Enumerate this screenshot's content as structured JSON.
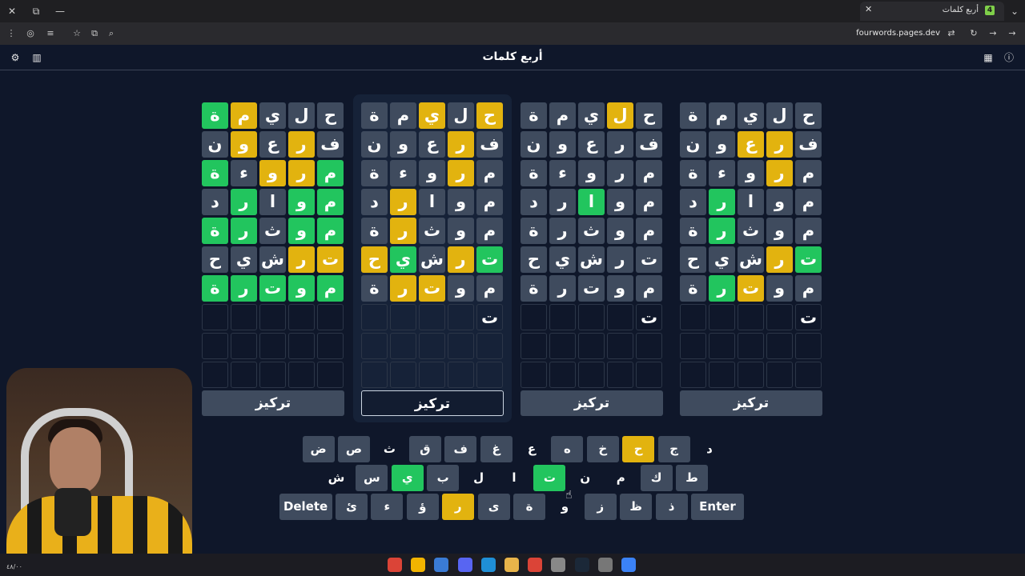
{
  "browser": {
    "tab_title": "أربع كلمات",
    "favicon_glyph": "4",
    "url": "fourwords.pages.dev"
  },
  "app": {
    "title": "أربع كلمات",
    "icons": {
      "settings": "gear-icon",
      "stats": "bar-chart-icon",
      "calendar": "calendar-icon",
      "info": "info-icon"
    }
  },
  "colors": {
    "correct": "#22c55e",
    "present": "#e2b30f",
    "absent": "#3f4b5e",
    "background": "#0f172a"
  },
  "boards": [
    {
      "focus_label": "تركيز",
      "active": false,
      "rows": [
        [
          {
            "l": "ح",
            "s": "a"
          },
          {
            "l": "ل",
            "s": "a"
          },
          {
            "l": "ي",
            "s": "a"
          },
          {
            "l": "م",
            "s": "y"
          },
          {
            "l": "ة",
            "s": "g"
          }
        ],
        [
          {
            "l": "ف",
            "s": "a"
          },
          {
            "l": "ر",
            "s": "y"
          },
          {
            "l": "ع",
            "s": "a"
          },
          {
            "l": "و",
            "s": "y"
          },
          {
            "l": "ن",
            "s": "a"
          }
        ],
        [
          {
            "l": "م",
            "s": "g"
          },
          {
            "l": "ر",
            "s": "y"
          },
          {
            "l": "و",
            "s": "y"
          },
          {
            "l": "ء",
            "s": "a"
          },
          {
            "l": "ة",
            "s": "g"
          }
        ],
        [
          {
            "l": "م",
            "s": "g"
          },
          {
            "l": "و",
            "s": "g"
          },
          {
            "l": "ا",
            "s": "a"
          },
          {
            "l": "ر",
            "s": "g"
          },
          {
            "l": "د",
            "s": "a"
          }
        ],
        [
          {
            "l": "م",
            "s": "g"
          },
          {
            "l": "و",
            "s": "g"
          },
          {
            "l": "ث",
            "s": "a"
          },
          {
            "l": "ر",
            "s": "g"
          },
          {
            "l": "ة",
            "s": "g"
          }
        ],
        [
          {
            "l": "ت",
            "s": "y"
          },
          {
            "l": "ر",
            "s": "y"
          },
          {
            "l": "ش",
            "s": "a"
          },
          {
            "l": "ي",
            "s": "a"
          },
          {
            "l": "ح",
            "s": "a"
          }
        ],
        [
          {
            "l": "م",
            "s": "g"
          },
          {
            "l": "و",
            "s": "g"
          },
          {
            "l": "ت",
            "s": "g"
          },
          {
            "l": "ر",
            "s": "g"
          },
          {
            "l": "ة",
            "s": "g"
          }
        ],
        [
          {
            "l": "",
            "s": "e"
          },
          {
            "l": "",
            "s": "e"
          },
          {
            "l": "",
            "s": "e"
          },
          {
            "l": "",
            "s": "e"
          },
          {
            "l": "",
            "s": "e"
          }
        ],
        [
          {
            "l": "",
            "s": "e"
          },
          {
            "l": "",
            "s": "e"
          },
          {
            "l": "",
            "s": "e"
          },
          {
            "l": "",
            "s": "e"
          },
          {
            "l": "",
            "s": "e"
          }
        ],
        [
          {
            "l": "",
            "s": "e"
          },
          {
            "l": "",
            "s": "e"
          },
          {
            "l": "",
            "s": "e"
          },
          {
            "l": "",
            "s": "e"
          },
          {
            "l": "",
            "s": "e"
          }
        ]
      ]
    },
    {
      "focus_label": "تركيز",
      "active": true,
      "rows": [
        [
          {
            "l": "ح",
            "s": "y"
          },
          {
            "l": "ل",
            "s": "a"
          },
          {
            "l": "ي",
            "s": "y"
          },
          {
            "l": "م",
            "s": "a"
          },
          {
            "l": "ة",
            "s": "a"
          }
        ],
        [
          {
            "l": "ف",
            "s": "a"
          },
          {
            "l": "ر",
            "s": "y"
          },
          {
            "l": "ع",
            "s": "a"
          },
          {
            "l": "و",
            "s": "a"
          },
          {
            "l": "ن",
            "s": "a"
          }
        ],
        [
          {
            "l": "م",
            "s": "a"
          },
          {
            "l": "ر",
            "s": "y"
          },
          {
            "l": "و",
            "s": "a"
          },
          {
            "l": "ء",
            "s": "a"
          },
          {
            "l": "ة",
            "s": "a"
          }
        ],
        [
          {
            "l": "م",
            "s": "a"
          },
          {
            "l": "و",
            "s": "a"
          },
          {
            "l": "ا",
            "s": "a"
          },
          {
            "l": "ر",
            "s": "y"
          },
          {
            "l": "د",
            "s": "a"
          }
        ],
        [
          {
            "l": "م",
            "s": "a"
          },
          {
            "l": "و",
            "s": "a"
          },
          {
            "l": "ث",
            "s": "a"
          },
          {
            "l": "ر",
            "s": "y"
          },
          {
            "l": "ة",
            "s": "a"
          }
        ],
        [
          {
            "l": "ت",
            "s": "g"
          },
          {
            "l": "ر",
            "s": "y"
          },
          {
            "l": "ش",
            "s": "a"
          },
          {
            "l": "ي",
            "s": "g"
          },
          {
            "l": "ح",
            "s": "y"
          }
        ],
        [
          {
            "l": "م",
            "s": "a"
          },
          {
            "l": "و",
            "s": "a"
          },
          {
            "l": "ت",
            "s": "y"
          },
          {
            "l": "ر",
            "s": "y"
          },
          {
            "l": "ة",
            "s": "a"
          }
        ],
        [
          {
            "l": "ت",
            "s": "c"
          },
          {
            "l": "",
            "s": "e"
          },
          {
            "l": "",
            "s": "e"
          },
          {
            "l": "",
            "s": "e"
          },
          {
            "l": "",
            "s": "e"
          }
        ],
        [
          {
            "l": "",
            "s": "e"
          },
          {
            "l": "",
            "s": "e"
          },
          {
            "l": "",
            "s": "e"
          },
          {
            "l": "",
            "s": "e"
          },
          {
            "l": "",
            "s": "e"
          }
        ],
        [
          {
            "l": "",
            "s": "e"
          },
          {
            "l": "",
            "s": "e"
          },
          {
            "l": "",
            "s": "e"
          },
          {
            "l": "",
            "s": "e"
          },
          {
            "l": "",
            "s": "e"
          }
        ]
      ]
    },
    {
      "focus_label": "تركيز",
      "active": false,
      "rows": [
        [
          {
            "l": "ح",
            "s": "a"
          },
          {
            "l": "ل",
            "s": "y"
          },
          {
            "l": "ي",
            "s": "a"
          },
          {
            "l": "م",
            "s": "a"
          },
          {
            "l": "ة",
            "s": "a"
          }
        ],
        [
          {
            "l": "ف",
            "s": "a"
          },
          {
            "l": "ر",
            "s": "a"
          },
          {
            "l": "ع",
            "s": "a"
          },
          {
            "l": "و",
            "s": "a"
          },
          {
            "l": "ن",
            "s": "a"
          }
        ],
        [
          {
            "l": "م",
            "s": "a"
          },
          {
            "l": "ر",
            "s": "a"
          },
          {
            "l": "و",
            "s": "a"
          },
          {
            "l": "ء",
            "s": "a"
          },
          {
            "l": "ة",
            "s": "a"
          }
        ],
        [
          {
            "l": "م",
            "s": "a"
          },
          {
            "l": "و",
            "s": "a"
          },
          {
            "l": "ا",
            "s": "g"
          },
          {
            "l": "ر",
            "s": "a"
          },
          {
            "l": "د",
            "s": "a"
          }
        ],
        [
          {
            "l": "م",
            "s": "a"
          },
          {
            "l": "و",
            "s": "a"
          },
          {
            "l": "ث",
            "s": "a"
          },
          {
            "l": "ر",
            "s": "a"
          },
          {
            "l": "ة",
            "s": "a"
          }
        ],
        [
          {
            "l": "ت",
            "s": "a"
          },
          {
            "l": "ر",
            "s": "a"
          },
          {
            "l": "ش",
            "s": "a"
          },
          {
            "l": "ي",
            "s": "a"
          },
          {
            "l": "ح",
            "s": "a"
          }
        ],
        [
          {
            "l": "م",
            "s": "a"
          },
          {
            "l": "و",
            "s": "a"
          },
          {
            "l": "ت",
            "s": "a"
          },
          {
            "l": "ر",
            "s": "a"
          },
          {
            "l": "ة",
            "s": "a"
          }
        ],
        [
          {
            "l": "ت",
            "s": "c"
          },
          {
            "l": "",
            "s": "e"
          },
          {
            "l": "",
            "s": "e"
          },
          {
            "l": "",
            "s": "e"
          },
          {
            "l": "",
            "s": "e"
          }
        ],
        [
          {
            "l": "",
            "s": "e"
          },
          {
            "l": "",
            "s": "e"
          },
          {
            "l": "",
            "s": "e"
          },
          {
            "l": "",
            "s": "e"
          },
          {
            "l": "",
            "s": "e"
          }
        ],
        [
          {
            "l": "",
            "s": "e"
          },
          {
            "l": "",
            "s": "e"
          },
          {
            "l": "",
            "s": "e"
          },
          {
            "l": "",
            "s": "e"
          },
          {
            "l": "",
            "s": "e"
          }
        ]
      ]
    },
    {
      "focus_label": "تركيز",
      "active": false,
      "rows": [
        [
          {
            "l": "ح",
            "s": "a"
          },
          {
            "l": "ل",
            "s": "a"
          },
          {
            "l": "ي",
            "s": "a"
          },
          {
            "l": "م",
            "s": "a"
          },
          {
            "l": "ة",
            "s": "a"
          }
        ],
        [
          {
            "l": "ف",
            "s": "a"
          },
          {
            "l": "ر",
            "s": "y"
          },
          {
            "l": "ع",
            "s": "y"
          },
          {
            "l": "و",
            "s": "a"
          },
          {
            "l": "ن",
            "s": "a"
          }
        ],
        [
          {
            "l": "م",
            "s": "a"
          },
          {
            "l": "ر",
            "s": "y"
          },
          {
            "l": "و",
            "s": "a"
          },
          {
            "l": "ء",
            "s": "a"
          },
          {
            "l": "ة",
            "s": "a"
          }
        ],
        [
          {
            "l": "م",
            "s": "a"
          },
          {
            "l": "و",
            "s": "a"
          },
          {
            "l": "ا",
            "s": "a"
          },
          {
            "l": "ر",
            "s": "g"
          },
          {
            "l": "د",
            "s": "a"
          }
        ],
        [
          {
            "l": "م",
            "s": "a"
          },
          {
            "l": "و",
            "s": "a"
          },
          {
            "l": "ث",
            "s": "a"
          },
          {
            "l": "ر",
            "s": "g"
          },
          {
            "l": "ة",
            "s": "a"
          }
        ],
        [
          {
            "l": "ت",
            "s": "g"
          },
          {
            "l": "ر",
            "s": "y"
          },
          {
            "l": "ش",
            "s": "a"
          },
          {
            "l": "ي",
            "s": "a"
          },
          {
            "l": "ح",
            "s": "a"
          }
        ],
        [
          {
            "l": "م",
            "s": "a"
          },
          {
            "l": "و",
            "s": "a"
          },
          {
            "l": "ت",
            "s": "y"
          },
          {
            "l": "ر",
            "s": "g"
          },
          {
            "l": "ة",
            "s": "a"
          }
        ],
        [
          {
            "l": "ت",
            "s": "c"
          },
          {
            "l": "",
            "s": "e"
          },
          {
            "l": "",
            "s": "e"
          },
          {
            "l": "",
            "s": "e"
          },
          {
            "l": "",
            "s": "e"
          }
        ],
        [
          {
            "l": "",
            "s": "e"
          },
          {
            "l": "",
            "s": "e"
          },
          {
            "l": "",
            "s": "e"
          },
          {
            "l": "",
            "s": "e"
          },
          {
            "l": "",
            "s": "e"
          }
        ],
        [
          {
            "l": "",
            "s": "e"
          },
          {
            "l": "",
            "s": "e"
          },
          {
            "l": "",
            "s": "e"
          },
          {
            "l": "",
            "s": "e"
          },
          {
            "l": "",
            "s": "e"
          }
        ]
      ]
    }
  ],
  "keyboard": {
    "rows": [
      [
        {
          "l": "د",
          "s": "d"
        },
        {
          "l": "ج",
          "s": "a"
        },
        {
          "l": "ح",
          "s": "y"
        },
        {
          "l": "خ",
          "s": "a"
        },
        {
          "l": "ه",
          "s": "a"
        },
        {
          "l": "ع",
          "s": "d"
        },
        {
          "l": "غ",
          "s": "a"
        },
        {
          "l": "ف",
          "s": "a"
        },
        {
          "l": "ق",
          "s": "a"
        },
        {
          "l": "ث",
          "s": "d"
        },
        {
          "l": "ص",
          "s": "a"
        },
        {
          "l": "ض",
          "s": "a"
        }
      ],
      [
        {
          "l": "ط",
          "s": "a"
        },
        {
          "l": "ك",
          "s": "a"
        },
        {
          "l": "م",
          "s": "d"
        },
        {
          "l": "ن",
          "s": "d"
        },
        {
          "l": "ت",
          "s": "g"
        },
        {
          "l": "ا",
          "s": "d"
        },
        {
          "l": "ل",
          "s": "d"
        },
        {
          "l": "ب",
          "s": "a"
        },
        {
          "l": "ي",
          "s": "g"
        },
        {
          "l": "س",
          "s": "a"
        },
        {
          "l": "ش",
          "s": "d"
        }
      ],
      [
        {
          "l": "Enter",
          "s": "a",
          "wide": true
        },
        {
          "l": "ذ",
          "s": "a"
        },
        {
          "l": "ظ",
          "s": "a"
        },
        {
          "l": "ز",
          "s": "a"
        },
        {
          "l": "و",
          "s": "d"
        },
        {
          "l": "ة",
          "s": "a"
        },
        {
          "l": "ى",
          "s": "a"
        },
        {
          "l": "ر",
          "s": "y"
        },
        {
          "l": "ؤ",
          "s": "a"
        },
        {
          "l": "ء",
          "s": "a"
        },
        {
          "l": "ئ",
          "s": "a"
        },
        {
          "l": "Delete",
          "s": "a",
          "wide": true
        }
      ]
    ]
  },
  "taskbar": {
    "clock": "٤٨/٠٠",
    "apps": [
      "chrome-icon",
      "r-app-icon",
      "app-icon",
      "discord-icon",
      "edge-icon",
      "folder-icon",
      "chrome-icon",
      "obs-icon",
      "steam-icon",
      "settings-icon",
      "windows-icon"
    ]
  }
}
